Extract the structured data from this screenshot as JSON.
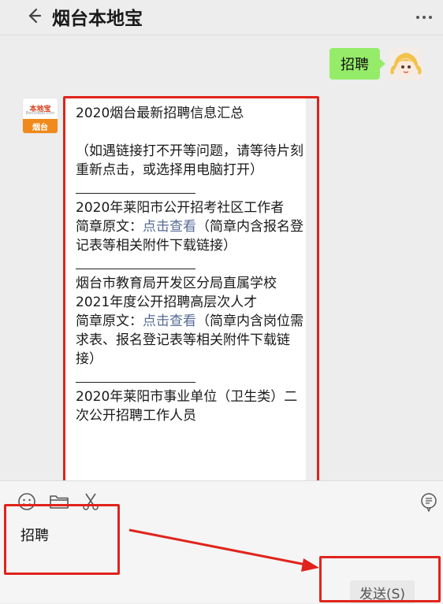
{
  "header": {
    "title": "烟台本地宝",
    "back_icon": "arrow-left-icon",
    "more_icon": "ellipsis-icon"
  },
  "chat": {
    "outgoing": {
      "text": "招聘"
    },
    "bot_avatar": {
      "brand": "本地宝",
      "domain": "BenDiBao.com",
      "city": "烟台"
    },
    "incoming": {
      "heading": "2020烟台最新招聘信息汇总",
      "notice": "（如遇链接打不开等问题，请等待片刻重新点击，或选择用电脑打开）",
      "item1_title": "2020年莱阳市公开招考社区工作者",
      "item1_prefix": "简章原文：",
      "item1_link": "点击查看",
      "item1_suffix": "（简章内含报名登记表等相关附件下载链接）",
      "item2_title": "烟台市教育局开发区分局直属学校2021年度公开招聘高层次人才",
      "item2_prefix": "简章原文：",
      "item2_link": "点击查看",
      "item2_suffix": "（简章内含岗位需求表、报名登记表等相关附件下载链接）",
      "item3_title": "2020年莱阳市事业单位（卫生类）二次公开招聘工作人员"
    }
  },
  "input": {
    "value": "招聘",
    "send_label": "发送(S)",
    "tools": [
      "emoji-icon",
      "folder-icon",
      "scissors-icon"
    ],
    "history_icon": "chat-history-icon"
  },
  "colors": {
    "outgoing_bubble": "#95ec69",
    "link": "#576b95",
    "annotation": "#e0241c"
  }
}
